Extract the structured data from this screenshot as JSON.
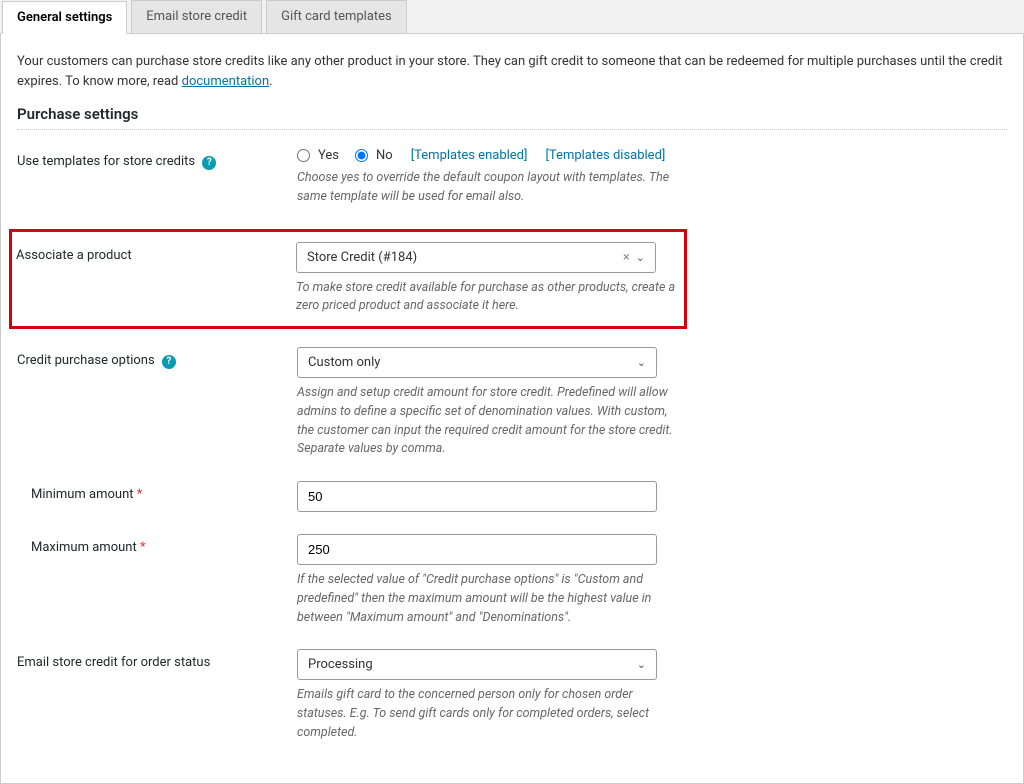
{
  "tabs": {
    "general": "General settings",
    "email": "Email store credit",
    "giftcard": "Gift card templates"
  },
  "intro": {
    "text_before": "Your customers can purchase store credits like any other product in your store. They can gift credit to someone that can be redeemed for multiple purchases until the credit expires. To know more, read ",
    "doc_link": "documentation",
    "text_after": "."
  },
  "section_title": "Purchase settings",
  "templates": {
    "label": "Use templates for store credits",
    "yes": "Yes",
    "no": "No",
    "enabled": "[Templates enabled]",
    "disabled": "[Templates disabled]",
    "desc": "Choose yes to override the default coupon layout with templates. The same template will be used for email also."
  },
  "associate": {
    "label": "Associate a product",
    "value": "Store Credit (#184)",
    "desc": "To make store credit available for purchase as other products, create a zero priced product and associate it here."
  },
  "purchase_options": {
    "label": "Credit purchase options",
    "value": "Custom only",
    "desc": "Assign and setup credit amount for store credit. Predefined will allow admins to define a specific set of denomination values. With custom, the customer can input the required credit amount for the store credit. Separate values by comma."
  },
  "min_amount": {
    "label": "Minimum amount",
    "value": "50"
  },
  "max_amount": {
    "label": "Maximum amount",
    "value": "250",
    "desc": "If the selected value of \"Credit purchase options\" is \"Custom and predefined\" then the maximum amount will be the highest value in between \"Maximum amount\" and \"Denominations\"."
  },
  "email_status": {
    "label": "Email store credit for order status",
    "value": "Processing",
    "desc": "Emails gift card to the concerned person only for chosen order statuses. E.g. To send gift cards only for completed orders, select completed."
  }
}
